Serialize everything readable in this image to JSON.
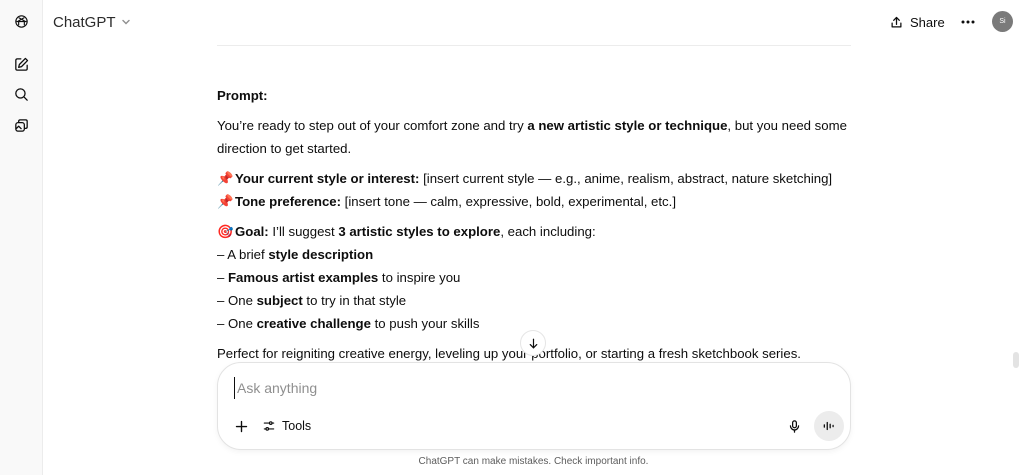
{
  "app": {
    "title": "ChatGPT"
  },
  "sidebar": {
    "items": [
      {
        "name": "new-chat",
        "icon": "edit-icon"
      },
      {
        "name": "search",
        "icon": "search-icon"
      },
      {
        "name": "library",
        "icon": "images-icon"
      }
    ]
  },
  "header": {
    "model_label": "ChatGPT",
    "share_label": "Share",
    "avatar_initials": "Si"
  },
  "message": {
    "prompt_label": "Prompt:",
    "intro_1": "You’re ready to step out of your comfort zone and try ",
    "intro_bold": "a new artistic style or technique",
    "intro_2": ", but you need some direction to get started.",
    "pin_emoji": "📌",
    "current_style_label": "Your current style or interest:",
    "current_style_value": " [insert current style — e.g., anime, realism, abstract, nature sketching]",
    "tone_label": "Tone preference:",
    "tone_value": " [insert tone — calm, expressive, bold, experimental, etc.]",
    "goal_emoji": "🎯",
    "goal_label": "Goal:",
    "goal_1": " I’ll suggest ",
    "goal_bold": "3 artistic styles to explore",
    "goal_2": ", each including:",
    "bullets": [
      {
        "pre": "– A brief ",
        "bold": "style description",
        "post": ""
      },
      {
        "pre": "– ",
        "bold": "Famous artist examples",
        "post": " to inspire you"
      },
      {
        "pre": "– One ",
        "bold": "subject",
        "post": " to try in that style"
      },
      {
        "pre": "– One ",
        "bold": "creative challenge",
        "post": " to push your skills"
      }
    ],
    "closing": "Perfect for reigniting creative energy, leveling up your portfolio, or starting a fresh sketchbook series."
  },
  "composer": {
    "placeholder": "Ask anything",
    "tools_label": "Tools"
  },
  "footer": {
    "note": "ChatGPT can make mistakes. Check important info."
  },
  "colors": {
    "text": "#0d0d0d",
    "muted": "#8f8f8f",
    "border": "#e3e3e3",
    "sidebar_bg": "#f9f9f9",
    "avatar_bg": "#7a7a7a"
  }
}
